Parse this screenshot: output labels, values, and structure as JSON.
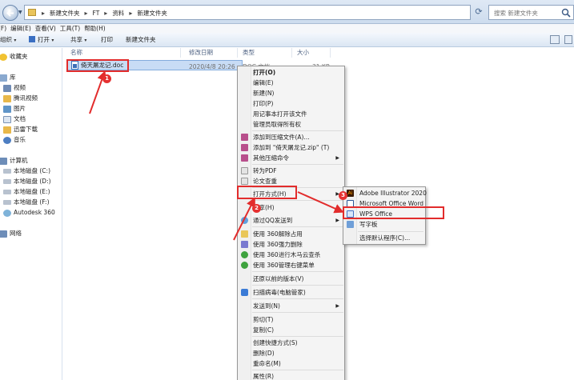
{
  "breadcrumb": [
    "新建文件夹",
    "FT",
    "资料",
    "新建文件夹"
  ],
  "search": {
    "placeholder": "搜索 新建文件夹"
  },
  "menubar": [
    "(F)",
    "编辑(E)",
    "查看(V)",
    "工具(T)",
    "帮助(H)"
  ],
  "toolbar": {
    "organize": "组织",
    "open": "打开",
    "share": "共享",
    "print": "打印",
    "new_folder": "新建文件夹"
  },
  "nav": {
    "favorites": "收藏夹",
    "libraries": "库",
    "lib_items": [
      "视频",
      "腾讯视频",
      "图片",
      "文档",
      "迅雷下载",
      "音乐"
    ],
    "computer": "计算机",
    "drives": [
      "本地磁盘 (C:)",
      "本地磁盘 (D:)",
      "本地磁盘 (E:)",
      "本地磁盘 (F:)",
      "Autodesk 360"
    ],
    "network": "网络"
  },
  "columns": {
    "name": "名称",
    "modified": "修改日期",
    "type": "类型",
    "size": "大小"
  },
  "file": {
    "name": "倚天屠龙记.doc",
    "date": "2020/4/8 20:26",
    "type": "DOC 文档",
    "size": "31 KB"
  },
  "context_menu": {
    "open": "打开(O)",
    "edit": "编辑(E)",
    "new": "新建(N)",
    "print": "打印(P)",
    "notepad": "用记事本打开该文件",
    "admin": "管理员取得所有权",
    "add_archive": "添加到压缩文件(A)...",
    "add_zip": "添加到 \"倚天屠龙记.zip\" (T)",
    "other_compress": "其他压缩命令",
    "to_pdf": "转为PDF",
    "paper_check": "论文查重",
    "open_with": "打开方式(H)",
    "share": "共享(H)",
    "qq_send": "通过QQ发送到",
    "unlock360": "使用 360解除占用",
    "shred360": "使用 360强力删除",
    "scan360": "使用 360进行木马云查杀",
    "menu360": "使用 360管理右键菜单",
    "restore": "还原以前的版本(V)",
    "virus_scan": "扫描病毒(电脑管家)",
    "send_to": "发送到(N)",
    "cut": "剪切(T)",
    "copy": "复制(C)",
    "shortcut": "创建快捷方式(S)",
    "delete": "删除(D)",
    "rename": "重命名(M)",
    "properties": "属性(R)"
  },
  "submenu": {
    "illustrator": "Adobe Illustrator 2020",
    "word": "Microsoft Office Word",
    "wps": "WPS Office",
    "wordpad": "写字板",
    "choose": "选择默认程序(C)..."
  },
  "badges": [
    "1",
    "2",
    "3"
  ],
  "colors": {
    "highlight": "#e22c2c",
    "badge": "#e53131",
    "selection": "#c8dcf5"
  }
}
